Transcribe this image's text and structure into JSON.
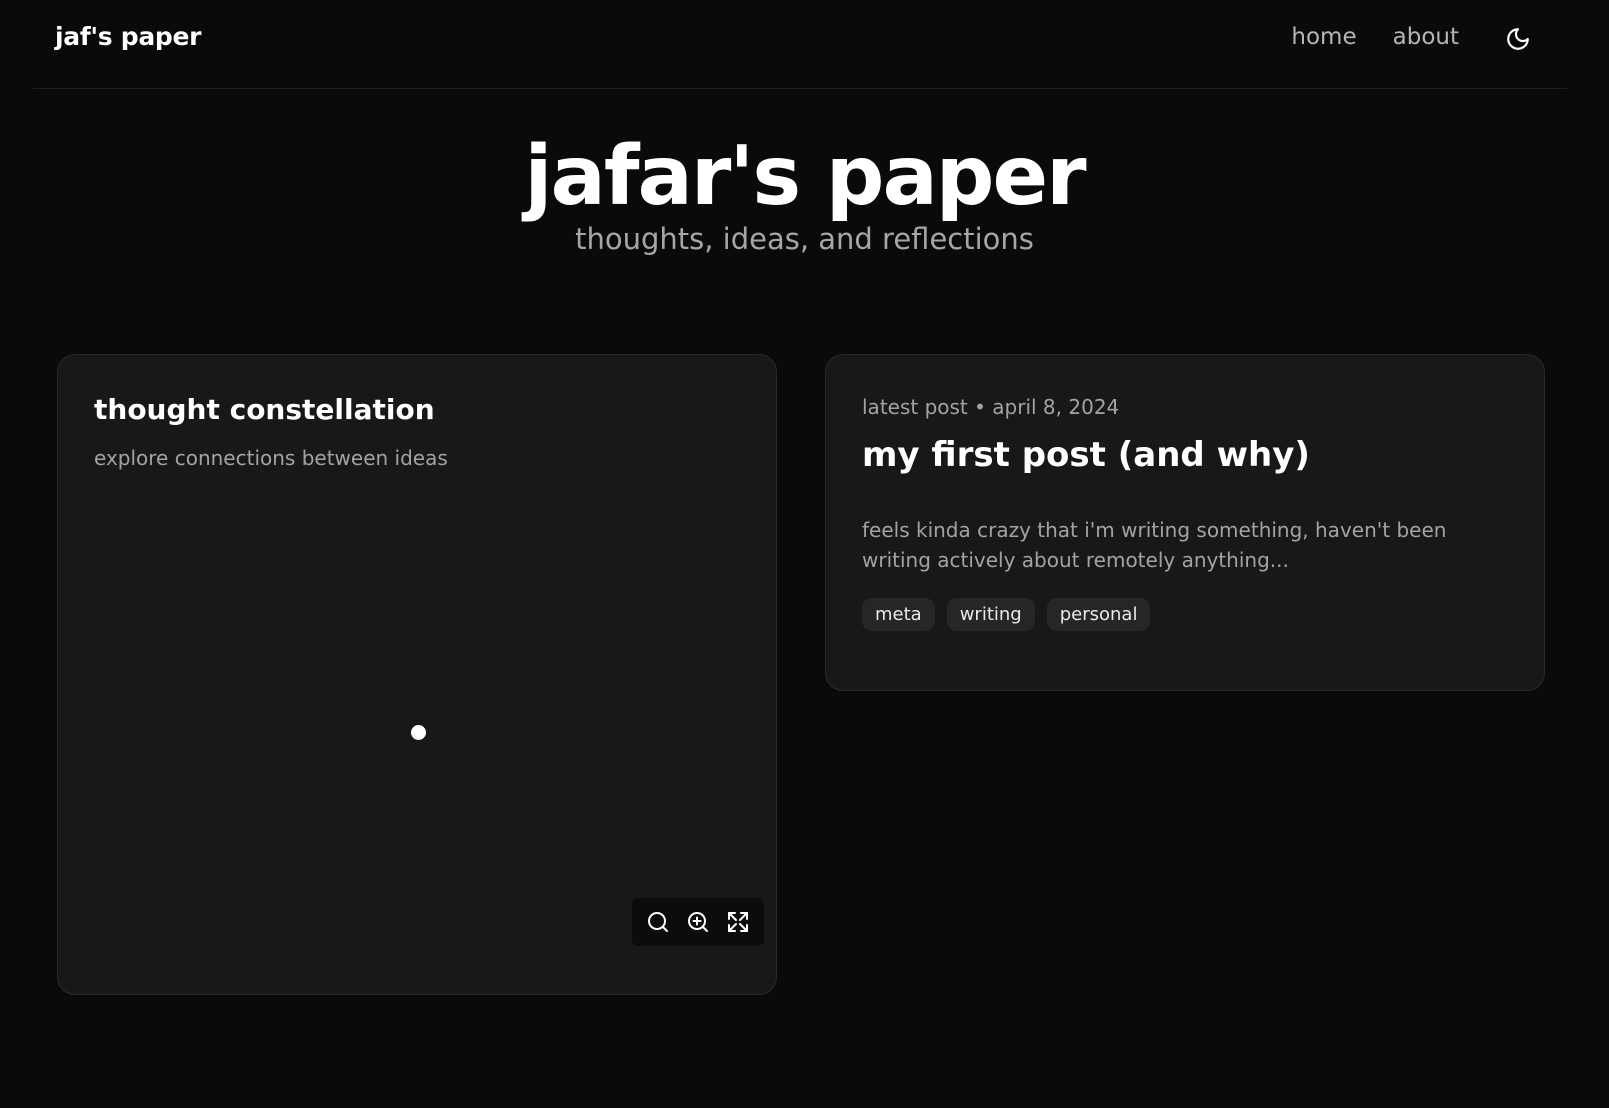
{
  "header": {
    "brand": "jaf's paper",
    "nav": [
      {
        "label": "home"
      },
      {
        "label": "about"
      }
    ],
    "theme_toggle_icon": "moon-icon"
  },
  "hero": {
    "title": "jafar's paper",
    "subtitle": "thoughts, ideas, and reflections"
  },
  "constellation": {
    "title": "thought constellation",
    "subtitle": "explore connections between ideas",
    "controls": [
      "search-icon",
      "zoom-in-icon",
      "fullscreen-icon"
    ]
  },
  "latest_post": {
    "meta": "latest post • april 8, 2024",
    "title": "my first post (and why)",
    "excerpt": "feels kinda crazy that i'm writing something, haven't been writing actively about remotely anything...",
    "tags": [
      "meta",
      "writing",
      "personal"
    ]
  },
  "colors": {
    "background": "#0a0a0a",
    "card": "#181818",
    "text_primary": "#ffffff",
    "text_muted": "#a3a3a3"
  }
}
